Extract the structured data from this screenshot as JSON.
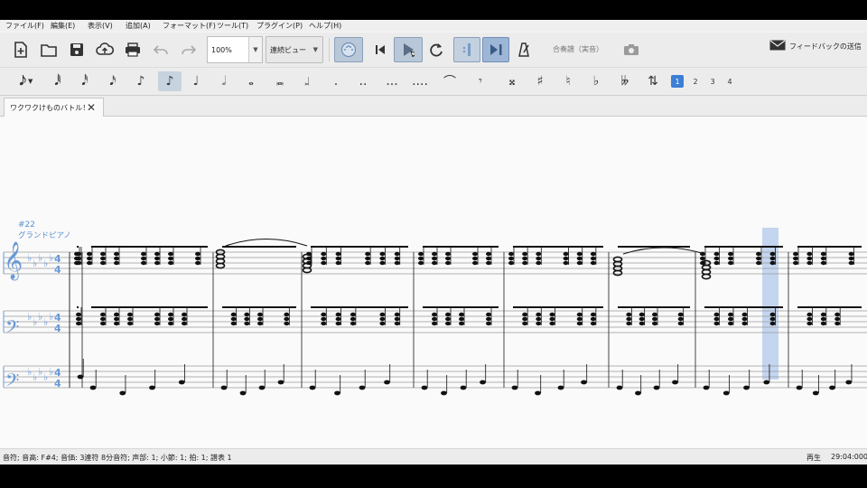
{
  "menu": [
    "ファイル(F)",
    "編集(E)",
    "表示(V)",
    "追加(A)",
    "フォーマット(F)",
    "ツール(T)",
    "プラグイン(P)",
    "ヘルプ(H)"
  ],
  "toolbar": {
    "zoom_value": "100%",
    "view_mode": "連続ビュー",
    "concert_pitch": "合奏譜（実音）",
    "feedback": "フィードバックの送信"
  },
  "voices": [
    "1",
    "2",
    "3",
    "4"
  ],
  "selected_voice": "1",
  "tab": {
    "title": "ワクワクけものバトル！"
  },
  "score": {
    "measure_number": "#22",
    "instrument": "グランドピアノ",
    "highlight_color": "#9fbde8"
  },
  "status": {
    "info": "音符; 音高: F#4; 音価: 3連符 8分音符; 声部: 1;  小節: 1; 拍: 1; 譜表 1",
    "state": "再生",
    "time": "29:04:000"
  },
  "colors": {
    "accent": "#3b7fd6",
    "instrument_label": "#5b8fd0"
  }
}
